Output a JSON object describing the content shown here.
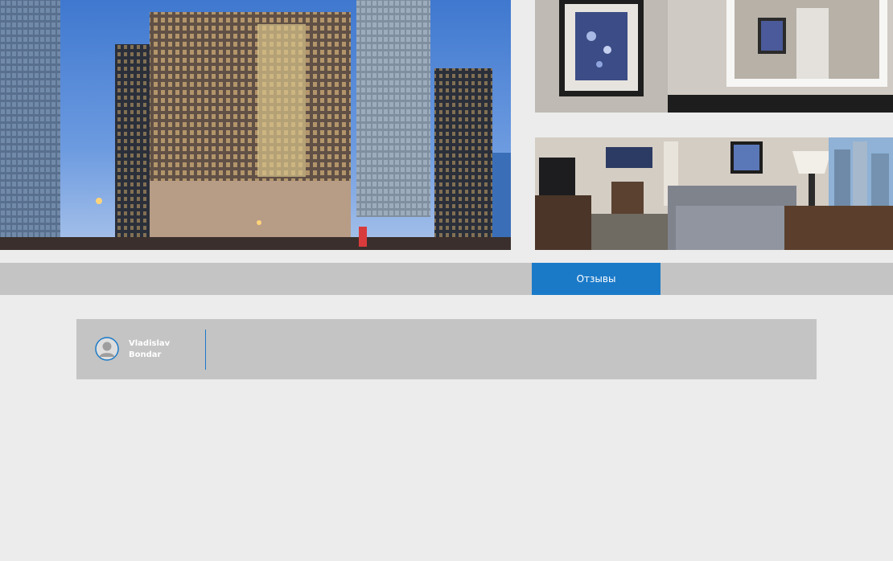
{
  "gallery": {
    "main_photo_icon": "hotel-exterior-photo",
    "bathroom_photo_icon": "hotel-bathroom-photo",
    "living_photo_icon": "hotel-living-room-photo"
  },
  "tabs": {
    "reviews_label": "Отзывы",
    "active_color": "#1b7ac8",
    "bar_color": "#c4c4c4"
  },
  "review": {
    "author_name": "Vladislav Bondar",
    "avatar_icon": "user-avatar-icon",
    "text": ""
  }
}
